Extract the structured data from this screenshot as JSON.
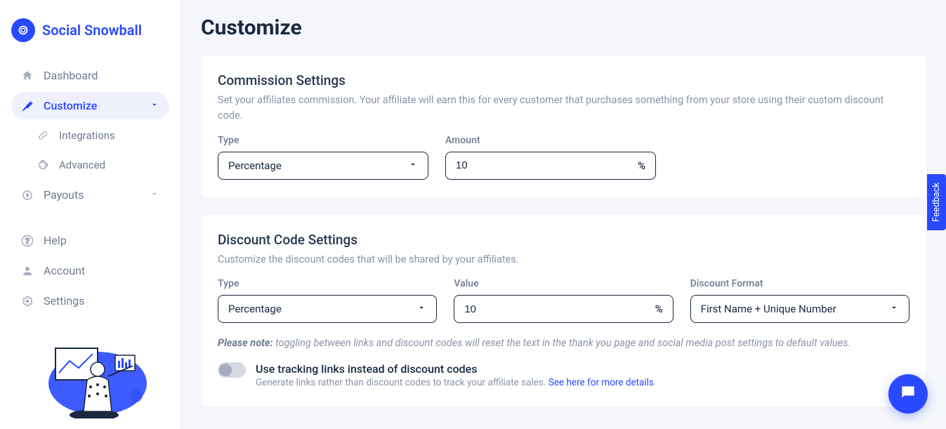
{
  "brand": {
    "name": "Social Snowball"
  },
  "sidebar": {
    "items": [
      {
        "label": "Dashboard"
      },
      {
        "label": "Customize"
      },
      {
        "label": "Integrations"
      },
      {
        "label": "Advanced"
      },
      {
        "label": "Payouts"
      },
      {
        "label": "Help"
      },
      {
        "label": "Account"
      },
      {
        "label": "Settings"
      }
    ]
  },
  "page": {
    "title": "Customize"
  },
  "commission": {
    "title": "Commission Settings",
    "desc": "Set your affiliates commission. Your affiliate will earn this for every customer that purchases something from your store using their custom discount code.",
    "type_label": "Type",
    "type_value": "Percentage",
    "amount_label": "Amount",
    "amount_value": "10",
    "amount_suffix": "%"
  },
  "discount": {
    "title": "Discount Code Settings",
    "desc": "Customize the discount codes that will be shared by your affiliates.",
    "type_label": "Type",
    "type_value": "Percentage",
    "value_label": "Value",
    "value_value": "10",
    "value_suffix": "%",
    "format_label": "Discount Format",
    "format_value": "First Name + Unique Number",
    "note_bold": "Please note:",
    "note_text": " toggling between links and discount codes will reset the text in the thank you page and social media post settings to default values.",
    "toggle_title": "Use tracking links instead of discount codes",
    "toggle_sub": "Generate links rather than discount codes to track your affiliate sales. ",
    "toggle_link": "See here for more details"
  },
  "feedback": {
    "label": "Feedback"
  }
}
